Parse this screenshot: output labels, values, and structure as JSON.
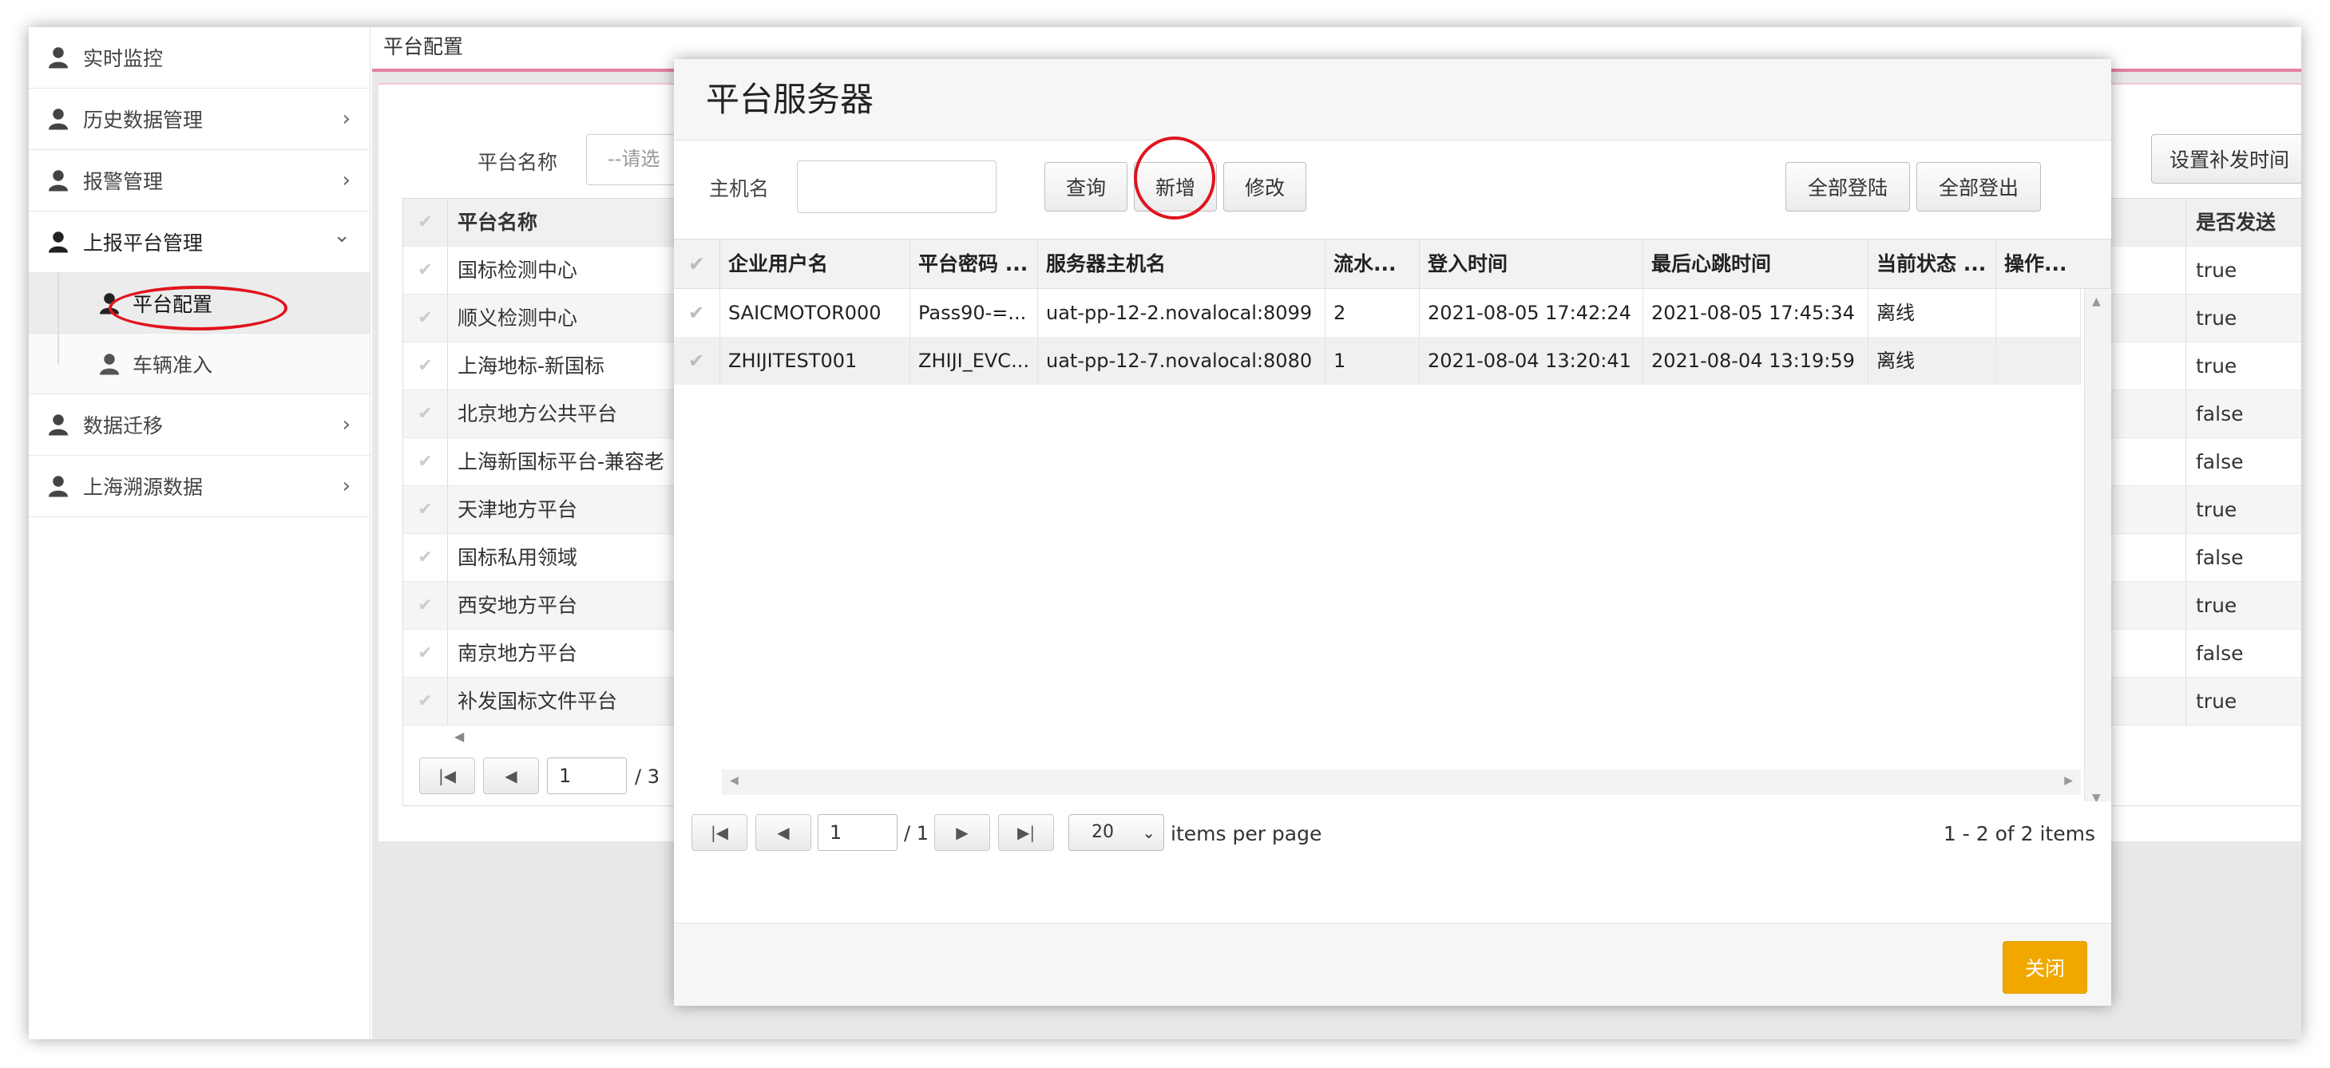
{
  "sidebar": {
    "items": [
      {
        "label": "实时监控",
        "chevron": ""
      },
      {
        "label": "历史数据管理",
        "chevron": "›"
      },
      {
        "label": "报警管理",
        "chevron": "›"
      },
      {
        "label": "上报平台管理",
        "chevron": "⌄"
      },
      {
        "label": "数据迁移",
        "chevron": "›"
      },
      {
        "label": "上海溯源数据",
        "chevron": "›"
      }
    ],
    "subitems": [
      {
        "label": "平台配置"
      },
      {
        "label": "车辆准入"
      }
    ]
  },
  "main": {
    "breadcrumb": "平台配置",
    "filter_label": "平台名称",
    "filter_placeholder": "--请选",
    "resend_button": "设置补发时间",
    "table_header_name": "平台名称",
    "table_header_right": "是否发送",
    "rows": [
      {
        "name": "国标检测中心",
        "flag": "true"
      },
      {
        "name": "顺义检测中心",
        "flag": "true"
      },
      {
        "name": "上海地标-新国标",
        "flag": "true"
      },
      {
        "name": "北京地方公共平台",
        "flag": "false"
      },
      {
        "name": "上海新国标平台-兼容老",
        "flag": "false"
      },
      {
        "name": "天津地方平台",
        "flag": "true"
      },
      {
        "name": "国标私用领域",
        "flag": "false"
      },
      {
        "name": "西安地方平台",
        "flag": "true"
      },
      {
        "name": "南京地方平台",
        "flag": "false"
      },
      {
        "name": "补发国标文件平台",
        "flag": "true"
      }
    ],
    "pager_page": "1",
    "pager_total": "/ 3"
  },
  "dialog": {
    "title": "平台服务器",
    "host_label": "主机名",
    "host_value": "",
    "buttons": {
      "query": "查询",
      "add": "新增",
      "edit": "修改",
      "login_all": "全部登陆",
      "logout_all": "全部登出"
    },
    "columns": [
      "企业用户名",
      "平台密码 ...",
      "服务器主机名",
      "流水...",
      "登入时间",
      "最后心跳时间",
      "当前状态 ...",
      "操作..."
    ],
    "rows": [
      {
        "user": "SAICMOTOR000",
        "pwd": "Pass90-=...",
        "host": "uat-pp-12-2.novalocal:8099",
        "serial": "2",
        "login": "2021-08-05 17:42:24",
        "heartbeat": "2021-08-05 17:45:34",
        "status": "离线",
        "op": ""
      },
      {
        "user": "ZHIJITEST001",
        "pwd": "ZHIJI_EVC...",
        "host": "uat-pp-12-7.novalocal:8080",
        "serial": "1",
        "login": "2021-08-04 13:20:41",
        "heartbeat": "2021-08-04 13:19:59",
        "status": "离线",
        "op": ""
      }
    ],
    "pager": {
      "page": "1",
      "total": "/ 1",
      "page_size": "20",
      "per_page_text": "items per page",
      "summary": "1 - 2 of 2 items"
    },
    "close_button": "关闭"
  },
  "colors": {
    "accent_pink": "#e57fa6",
    "close_orange": "#f0a800",
    "annotation_red": "#e0141e"
  }
}
